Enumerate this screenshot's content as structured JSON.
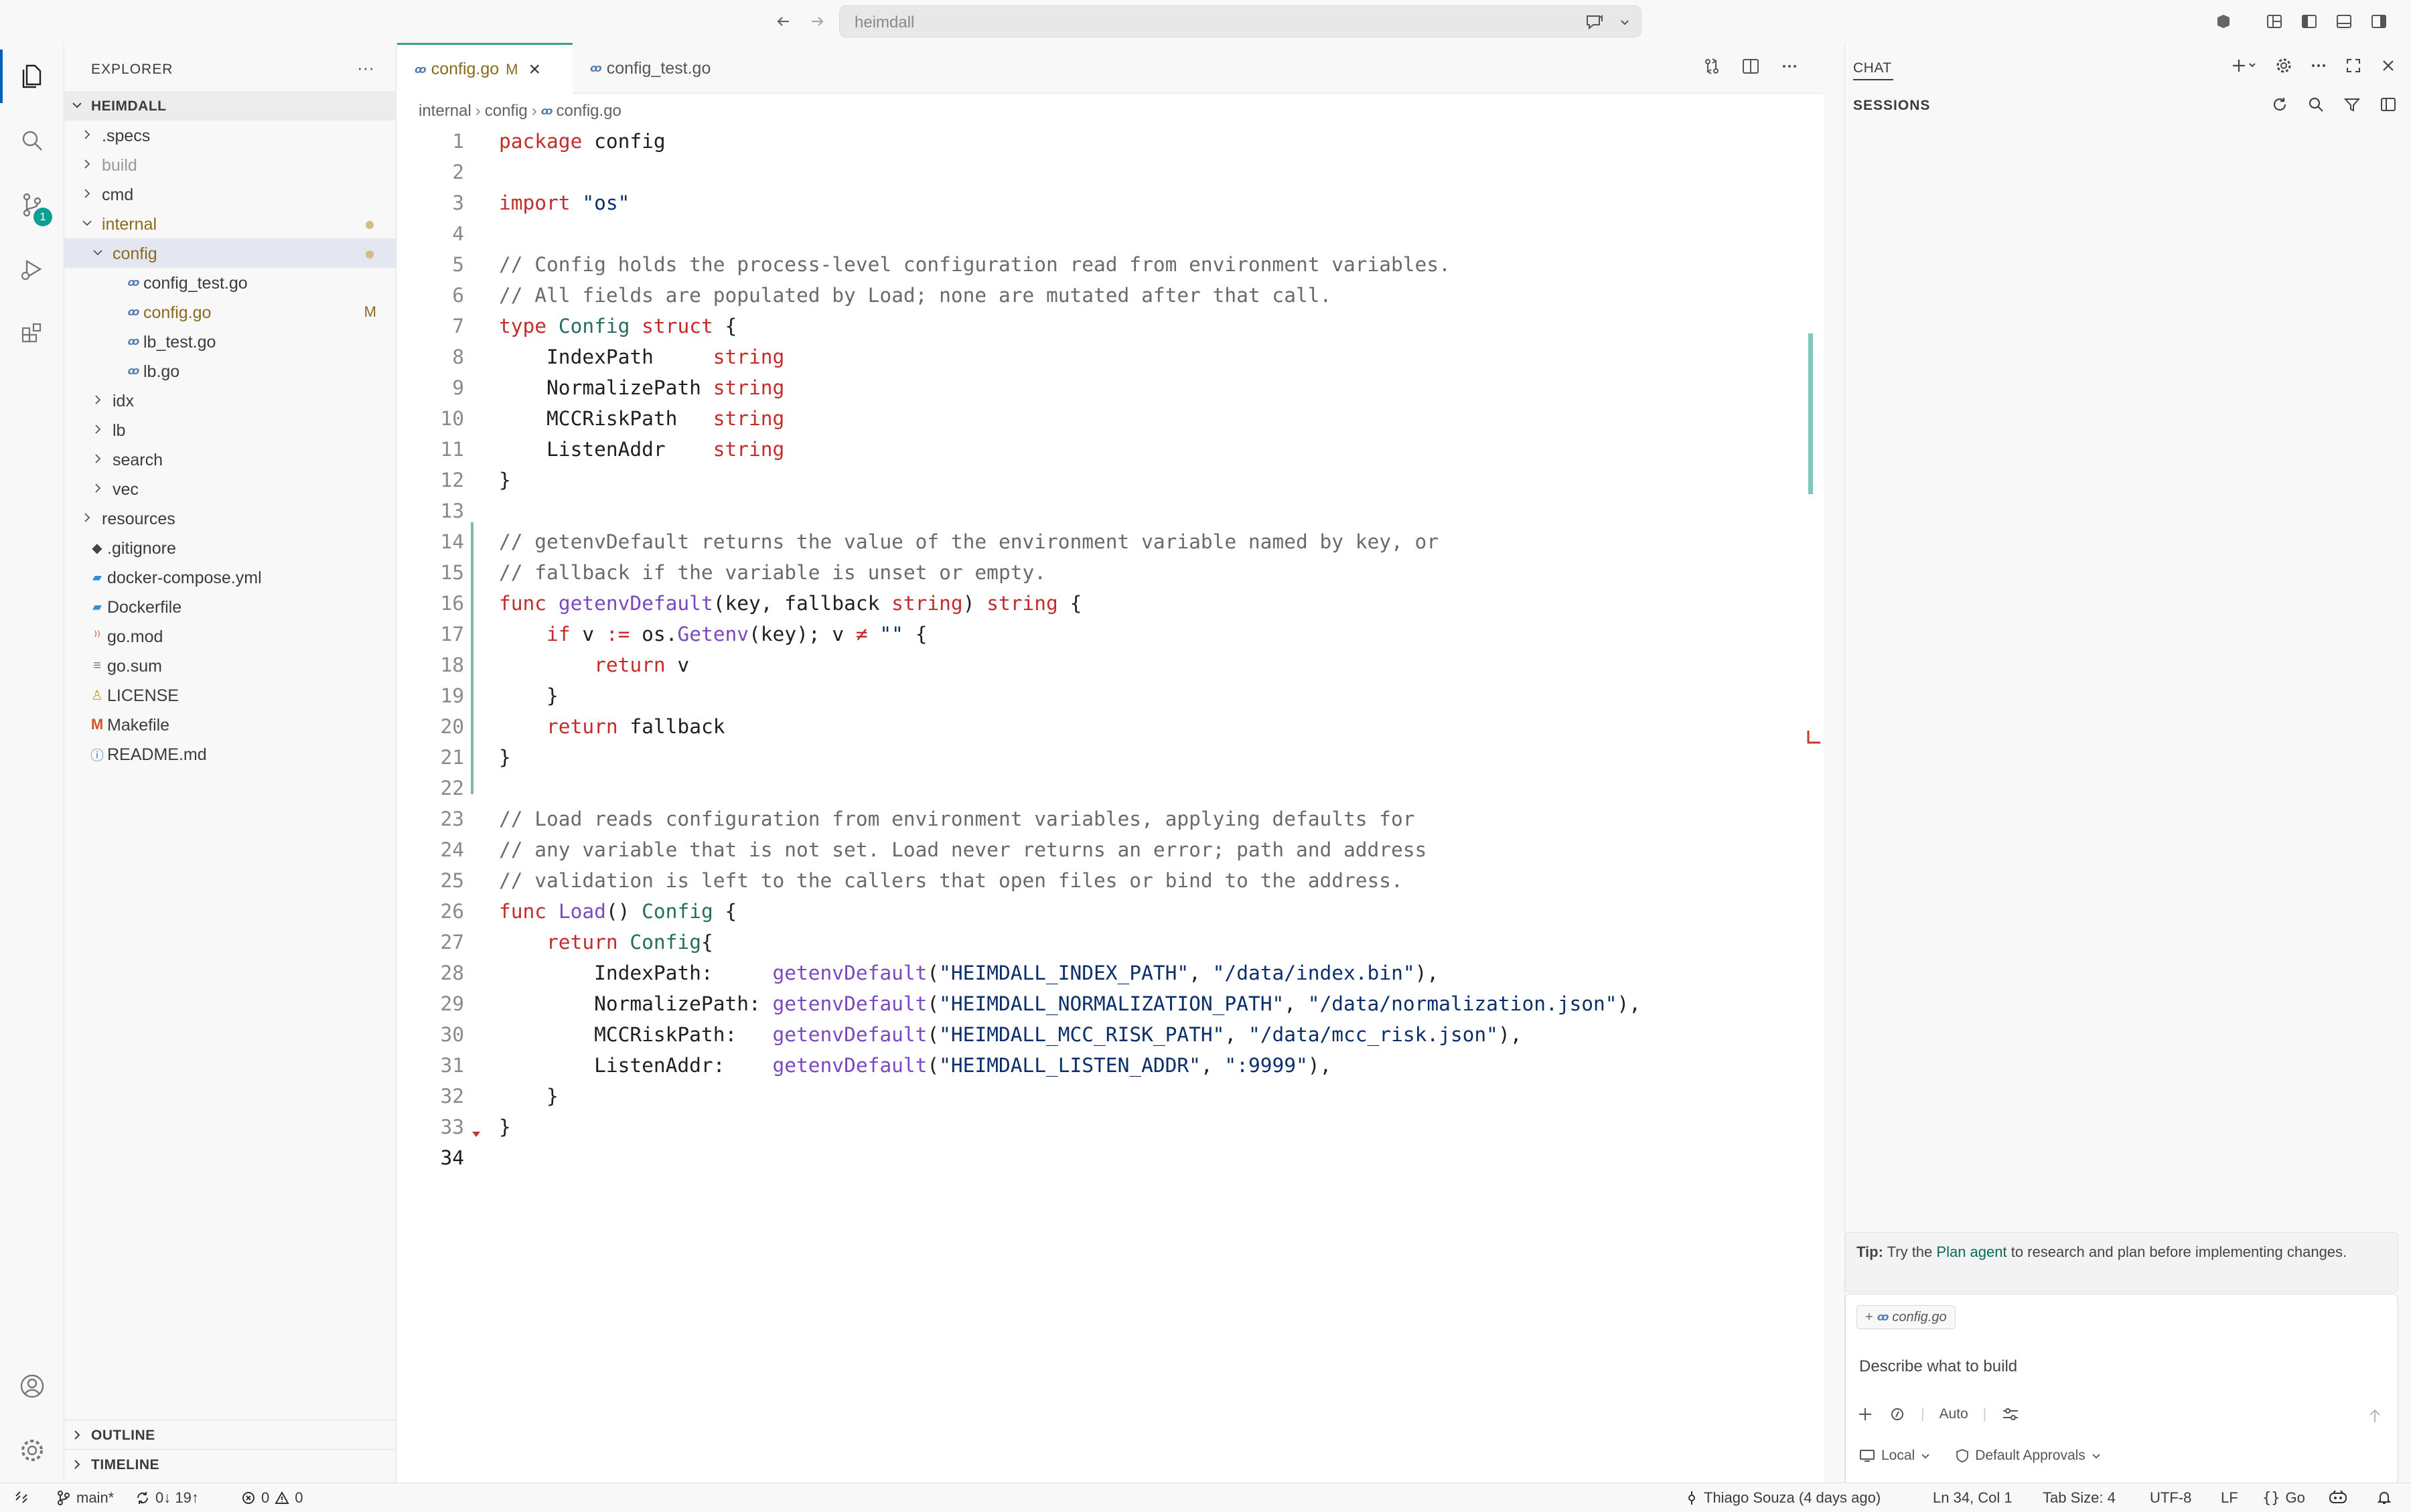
{
  "titlebar": {
    "search_text": "heimdall"
  },
  "activity": {
    "scm_badge": "1"
  },
  "explorer": {
    "title": "EXPLORER",
    "more": "···",
    "root": "HEIMDALL",
    "items": [
      {
        "label": ".specs",
        "kind": "folder",
        "state": "collapsed",
        "level": 0
      },
      {
        "label": "build",
        "kind": "folder",
        "state": "collapsed",
        "level": 0,
        "dim": true
      },
      {
        "label": "cmd",
        "kind": "folder",
        "state": "collapsed",
        "level": 0
      },
      {
        "label": "internal",
        "kind": "folder",
        "state": "expanded",
        "level": 0,
        "modified": true
      },
      {
        "label": "config",
        "kind": "folder",
        "state": "expanded",
        "level": 1,
        "modified": true,
        "selected": true
      },
      {
        "label": "config_test.go",
        "kind": "go",
        "level": 2
      },
      {
        "label": "config.go",
        "kind": "go",
        "level": 2,
        "badge": "M"
      },
      {
        "label": "lb_test.go",
        "kind": "go",
        "level": 2
      },
      {
        "label": "lb.go",
        "kind": "go",
        "level": 2
      },
      {
        "label": "idx",
        "kind": "folder",
        "state": "collapsed",
        "level": 1
      },
      {
        "label": "lb",
        "kind": "folder",
        "state": "collapsed",
        "level": 1
      },
      {
        "label": "search",
        "kind": "folder",
        "state": "collapsed",
        "level": 1
      },
      {
        "label": "vec",
        "kind": "folder",
        "state": "collapsed",
        "level": 1
      },
      {
        "label": "resources",
        "kind": "folder",
        "state": "collapsed",
        "level": 0
      },
      {
        "label": ".gitignore",
        "kind": "git",
        "level": 0
      },
      {
        "label": "docker-compose.yml",
        "kind": "docker",
        "level": 0
      },
      {
        "label": "Dockerfile",
        "kind": "docker",
        "level": 0
      },
      {
        "label": "go.mod",
        "kind": "gomod",
        "level": 0
      },
      {
        "label": "go.sum",
        "kind": "gosum",
        "level": 0
      },
      {
        "label": "LICENSE",
        "kind": "license",
        "level": 0
      },
      {
        "label": "Makefile",
        "kind": "make",
        "level": 0
      },
      {
        "label": "README.md",
        "kind": "info",
        "level": 0
      }
    ],
    "outline": "OUTLINE",
    "timeline": "TIMELINE"
  },
  "editor": {
    "tabs": [
      {
        "label": "config.go",
        "badge": "M",
        "close": "×"
      },
      {
        "label": "config_test.go"
      }
    ],
    "breadcrumb": [
      "internal",
      "config",
      "config.go"
    ],
    "lines": [
      [
        [
          "k",
          "package"
        ],
        [
          "n",
          " config"
        ]
      ],
      [],
      [
        [
          "k",
          "import"
        ],
        [
          "n",
          " "
        ],
        [
          "s",
          "\"os\""
        ]
      ],
      [],
      [
        [
          "c",
          "// Config holds the process-level configuration read from environment variables."
        ]
      ],
      [
        [
          "c",
          "// All fields are populated by Load; none are mutated after that call."
        ]
      ],
      [
        [
          "k",
          "type"
        ],
        [
          "n",
          " "
        ],
        [
          "y",
          "Config"
        ],
        [
          "n",
          " "
        ],
        [
          "k",
          "struct"
        ],
        [
          "n",
          " {"
        ]
      ],
      [
        [
          "n",
          "    IndexPath     "
        ],
        [
          "t",
          "string"
        ]
      ],
      [
        [
          "n",
          "    NormalizePath "
        ],
        [
          "t",
          "string"
        ]
      ],
      [
        [
          "n",
          "    MCCRiskPath   "
        ],
        [
          "t",
          "string"
        ]
      ],
      [
        [
          "n",
          "    ListenAddr    "
        ],
        [
          "t",
          "string"
        ]
      ],
      [
        [
          "n",
          "}"
        ]
      ],
      [],
      [
        [
          "c",
          "// getenvDefault returns the value of the environment variable named by key, or"
        ]
      ],
      [
        [
          "c",
          "// fallback if the variable is unset or empty."
        ]
      ],
      [
        [
          "k",
          "func"
        ],
        [
          "n",
          " "
        ],
        [
          "f",
          "getenvDefault"
        ],
        [
          "n",
          "(key, fallback "
        ],
        [
          "t",
          "string"
        ],
        [
          "n",
          ") "
        ],
        [
          "t",
          "string"
        ],
        [
          "n",
          " {"
        ]
      ],
      [
        [
          "n",
          "    "
        ],
        [
          "k",
          "if"
        ],
        [
          "n",
          " v "
        ],
        [
          "k",
          ":="
        ],
        [
          "n",
          " os."
        ],
        [
          "f",
          "Getenv"
        ],
        [
          "n",
          "(key); v "
        ],
        [
          "k",
          "≠"
        ],
        [
          "n",
          " "
        ],
        [
          "s",
          "\"\""
        ],
        [
          "n",
          " {"
        ]
      ],
      [
        [
          "n",
          "        "
        ],
        [
          "k",
          "return"
        ],
        [
          "n",
          " v"
        ]
      ],
      [
        [
          "n",
          "    }"
        ]
      ],
      [
        [
          "n",
          "    "
        ],
        [
          "k",
          "return"
        ],
        [
          "n",
          " fallback"
        ]
      ],
      [
        [
          "n",
          "}"
        ]
      ],
      [],
      [
        [
          "c",
          "// Load reads configuration from environment variables, applying defaults for"
        ]
      ],
      [
        [
          "c",
          "// any variable that is not set. Load never returns an error; path and address"
        ]
      ],
      [
        [
          "c",
          "// validation is left to the callers that open files or bind to the address."
        ]
      ],
      [
        [
          "k",
          "func"
        ],
        [
          "n",
          " "
        ],
        [
          "f",
          "Load"
        ],
        [
          "n",
          "() "
        ],
        [
          "y",
          "Config"
        ],
        [
          "n",
          " {"
        ]
      ],
      [
        [
          "n",
          "    "
        ],
        [
          "k",
          "return"
        ],
        [
          "n",
          " "
        ],
        [
          "y",
          "Config"
        ],
        [
          "n",
          "{"
        ]
      ],
      [
        [
          "n",
          "        IndexPath:     "
        ],
        [
          "f",
          "getenvDefault"
        ],
        [
          "n",
          "("
        ],
        [
          "s",
          "\"HEIMDALL_INDEX_PATH\""
        ],
        [
          "n",
          ", "
        ],
        [
          "s",
          "\"/data/index.bin\""
        ],
        [
          "n",
          "),"
        ]
      ],
      [
        [
          "n",
          "        NormalizePath: "
        ],
        [
          "f",
          "getenvDefault"
        ],
        [
          "n",
          "("
        ],
        [
          "s",
          "\"HEIMDALL_NORMALIZATION_PATH\""
        ],
        [
          "n",
          ", "
        ],
        [
          "s",
          "\"/data/normalization.json\""
        ],
        [
          "n",
          "),"
        ]
      ],
      [
        [
          "n",
          "        MCCRiskPath:   "
        ],
        [
          "f",
          "getenvDefault"
        ],
        [
          "n",
          "("
        ],
        [
          "s",
          "\"HEIMDALL_MCC_RISK_PATH\""
        ],
        [
          "n",
          ", "
        ],
        [
          "s",
          "\"/data/mcc_risk.json\""
        ],
        [
          "n",
          "),"
        ]
      ],
      [
        [
          "n",
          "        ListenAddr:    "
        ],
        [
          "f",
          "getenvDefault"
        ],
        [
          "n",
          "("
        ],
        [
          "s",
          "\"HEIMDALL_LISTEN_ADDR\""
        ],
        [
          "n",
          ", "
        ],
        [
          "s",
          "\":9999\""
        ],
        [
          "n",
          "),"
        ]
      ],
      [
        [
          "n",
          "    }"
        ]
      ],
      [
        [
          "n",
          "}"
        ]
      ],
      []
    ],
    "current_line": 34,
    "modified_lines": [
      13,
      21
    ]
  },
  "chat": {
    "tab": "CHAT",
    "sessions": "SESSIONS",
    "tip_bold": "Tip:",
    "tip_pre": " Try the ",
    "tip_link": "Plan agent",
    "tip_post": " to research and plan before implementing changes.",
    "context_file": "config.go",
    "placeholder": "Describe what to build",
    "mode": "Auto",
    "footer_local": "Local",
    "footer_approvals": "Default Approvals"
  },
  "status": {
    "branch": "main*",
    "sync": "0↓ 19↑",
    "errors": "0",
    "warnings": "0",
    "blame": "Thiago Souza (4 days ago)",
    "position": "Ln 34, Col 1",
    "tab_size": "Tab Size: 4",
    "encoding": "UTF-8",
    "eol": "LF",
    "language": "Go"
  },
  "colors": {
    "accent": "#005fb8",
    "scm_badge": "#0f9f92",
    "modified": "#8a6b1e",
    "gutter_modified": "#7fb8a8"
  }
}
